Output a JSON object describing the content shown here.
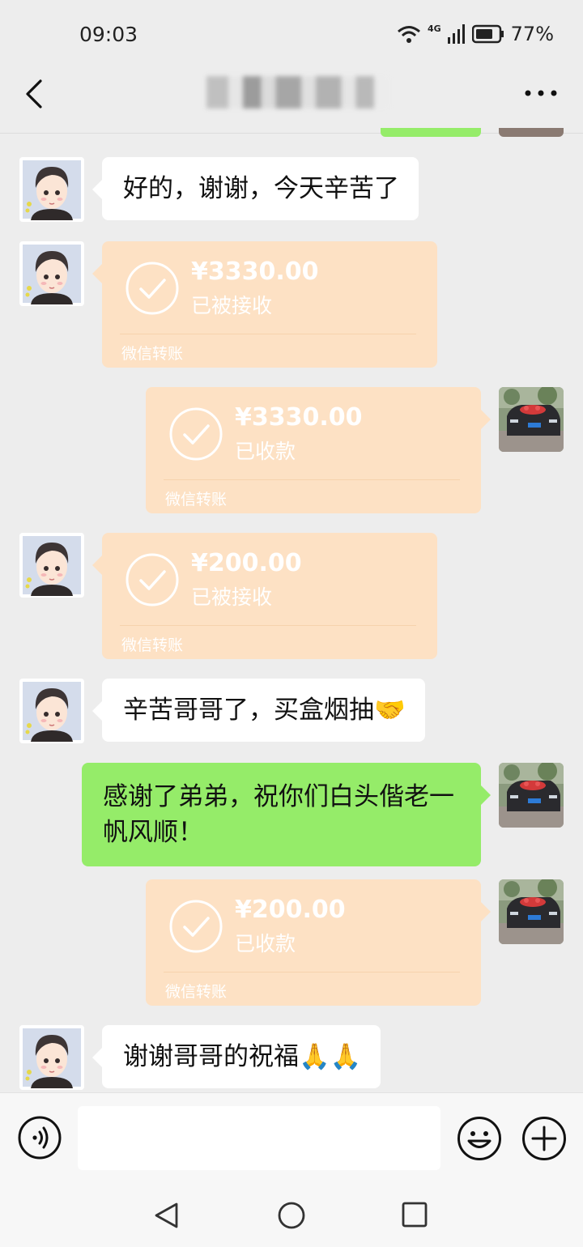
{
  "status_bar": {
    "time": "09:03",
    "network": "4G",
    "battery": "77%"
  },
  "header": {
    "title": ""
  },
  "messages": [
    {
      "side": "left",
      "type": "text",
      "text": "好的，谢谢，今天辛苦了"
    },
    {
      "side": "left",
      "type": "transfer",
      "amount": "¥3330.00",
      "status": "已被接收",
      "label": "微信转账"
    },
    {
      "side": "right",
      "type": "transfer",
      "amount": "¥3330.00",
      "status": "已收款",
      "label": "微信转账"
    },
    {
      "side": "left",
      "type": "transfer",
      "amount": "¥200.00",
      "status": "已被接收",
      "label": "微信转账"
    },
    {
      "side": "left",
      "type": "text",
      "text": "辛苦哥哥了，买盒烟抽🤝"
    },
    {
      "side": "right",
      "type": "text",
      "text": "感谢了弟弟，祝你们白头偕老一帆风顺！"
    },
    {
      "side": "right",
      "type": "transfer",
      "amount": "¥200.00",
      "status": "已收款",
      "label": "微信转账"
    },
    {
      "side": "left",
      "type": "text",
      "text": "谢谢哥哥的祝福🙏🙏"
    }
  ],
  "input": {
    "placeholder": "",
    "value": ""
  },
  "icons": {
    "back": "chevron-left-icon",
    "more": "more-icon",
    "voice": "voice-icon",
    "emoji": "emoji-icon",
    "plus": "plus-icon",
    "nav_back": "nav-back-icon",
    "nav_home": "nav-home-icon",
    "nav_recent": "nav-recent-icon"
  },
  "colors": {
    "background": "#ededed",
    "self_bubble": "#95ec69",
    "other_bubble": "#ffffff",
    "transfer_card": "#fde1c4"
  }
}
